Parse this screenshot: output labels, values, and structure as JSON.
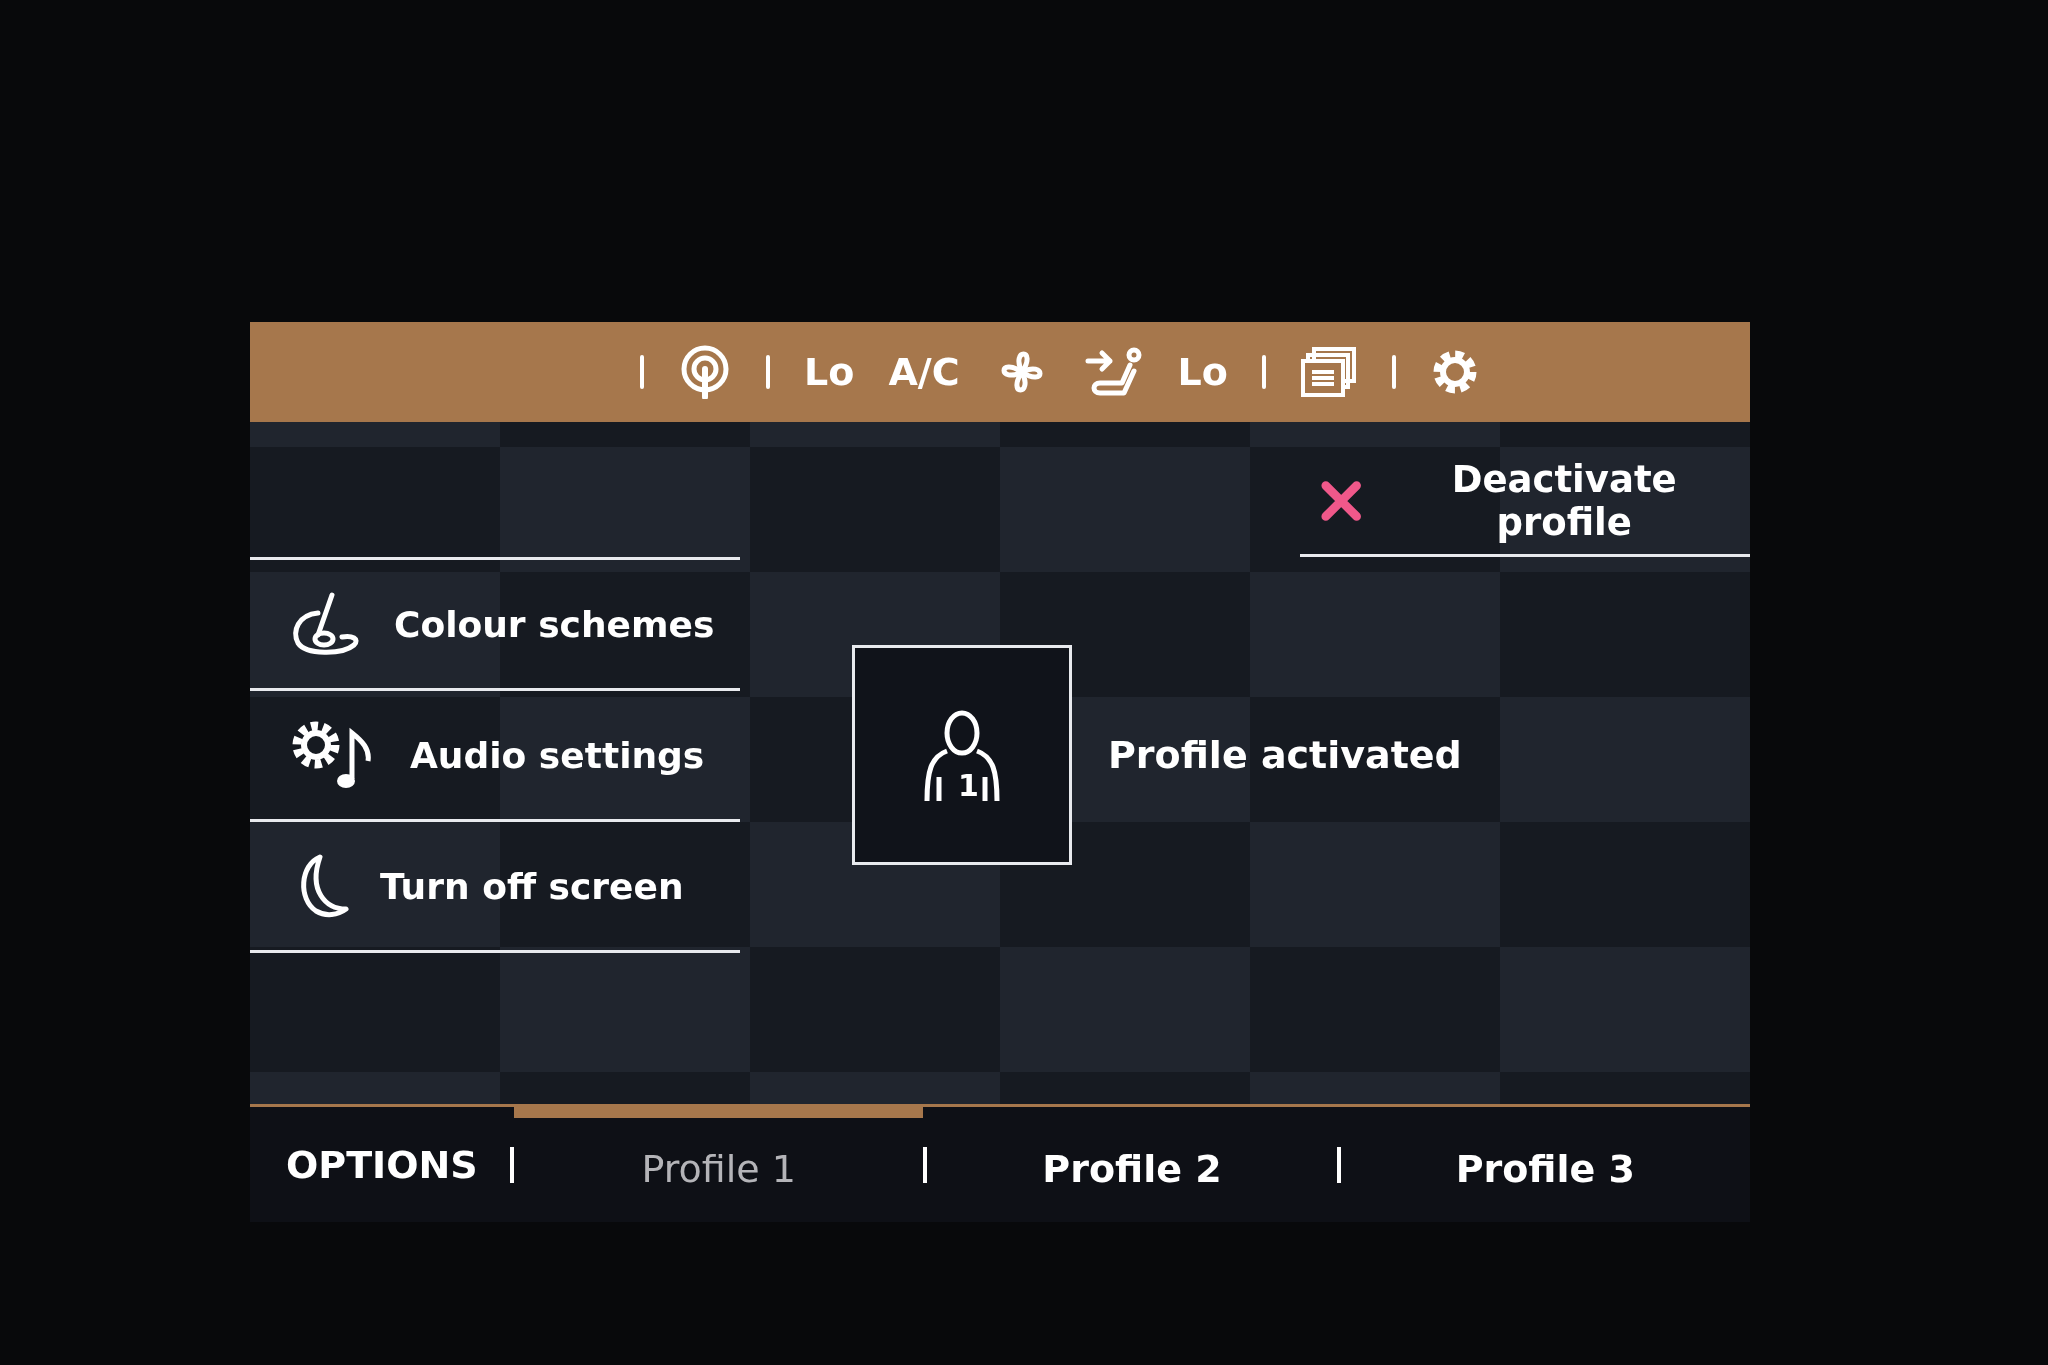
{
  "climate_bar": {
    "left_temperature": "Lo",
    "ac_label": "A/C",
    "right_temperature": "Lo"
  },
  "deactivate_button": {
    "label": "Deactivate profile"
  },
  "menu": [
    {
      "kind": "palette",
      "label": "Colour schemes"
    },
    {
      "kind": "audio",
      "label": "Audio settings"
    },
    {
      "kind": "moon",
      "label": "Turn off screen"
    }
  ],
  "profile_card": {
    "number": "1",
    "status": "Profile activated"
  },
  "options_button": {
    "label": "OPTIONS"
  },
  "tabs": [
    {
      "label": "Profile 1",
      "selected": true
    },
    {
      "label": "Profile 2",
      "selected": false
    },
    {
      "label": "Profile 3",
      "selected": false
    }
  ]
}
